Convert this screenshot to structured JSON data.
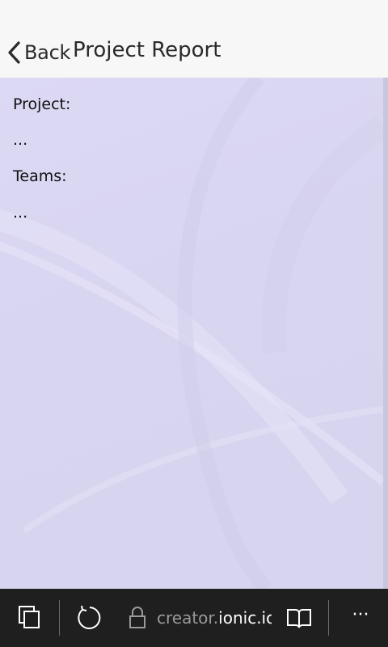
{
  "header": {
    "back_label": "Back",
    "title": "Project Report"
  },
  "content": {
    "project_label": "Project:",
    "project_value": "...",
    "teams_label": "Teams:",
    "teams_value": "..."
  },
  "browser_bar": {
    "url_prefix": "creator.",
    "url_host": "ionic.io",
    "more_label": "···",
    "icons": [
      "tabs-icon",
      "refresh-icon",
      "lock-icon",
      "reading-view-icon",
      "more-icon"
    ]
  },
  "colors": {
    "header_bg": "#f7f7f7",
    "content_bg": "#dcdaf4",
    "browser_bar_bg": "#1f1f1f"
  }
}
